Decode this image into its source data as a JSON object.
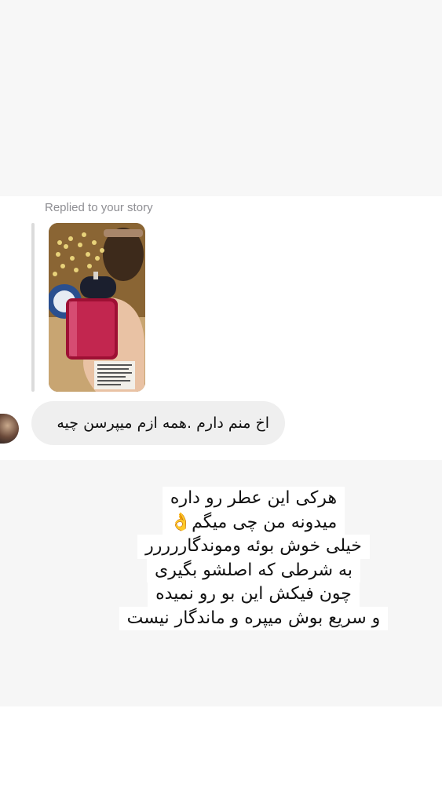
{
  "reply": {
    "label": "Replied to your story"
  },
  "message": {
    "text": "اخ منم دارم .همه ازم میپرسن چیه"
  },
  "story_caption": {
    "lines": [
      "هرکی این عطر رو داره",
      "میدونه من چی میگم👌",
      "خیلی خوش بوئه وموندگاررررر",
      "به شرطی که اصلشو بگیری",
      "چون فیکش این بو رو نمیده",
      "و سریع بوش میپره و ماندگار نیست"
    ]
  },
  "colors": {
    "bubble": "#efefef",
    "label": "#8e8e93",
    "reply_bar": "#dbdbdb",
    "perfume_liquid": "#b3123f"
  }
}
